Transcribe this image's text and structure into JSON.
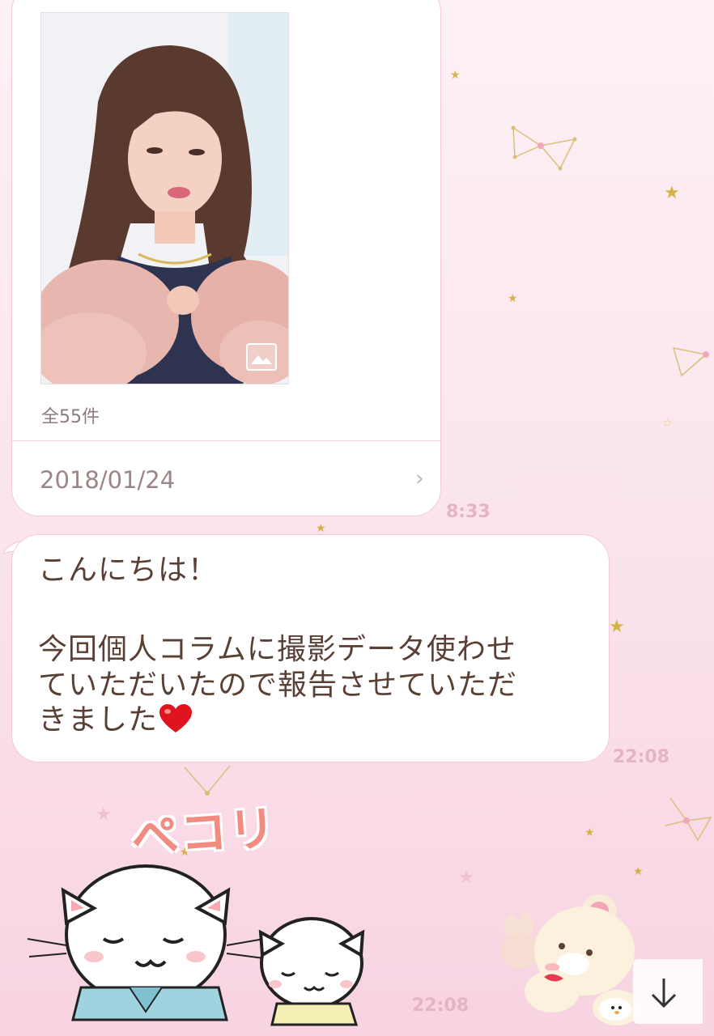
{
  "album": {
    "count_label": "全55件",
    "date": "2018/01/24",
    "time": "8:33"
  },
  "message": {
    "greeting": "こんにちは！",
    "lines": [
      "今回個人コラムに撮影データ使わせ",
      "ていただいたので報告させていただ",
      "きました"
    ],
    "time": "22:08"
  },
  "sticker": {
    "text": "ぺコリ",
    "time": "22:08"
  },
  "icons": {
    "photo_badge": "image-icon",
    "chevron": "chevron-right-icon",
    "heart": "heart-icon",
    "scroll": "arrow-down-icon"
  }
}
